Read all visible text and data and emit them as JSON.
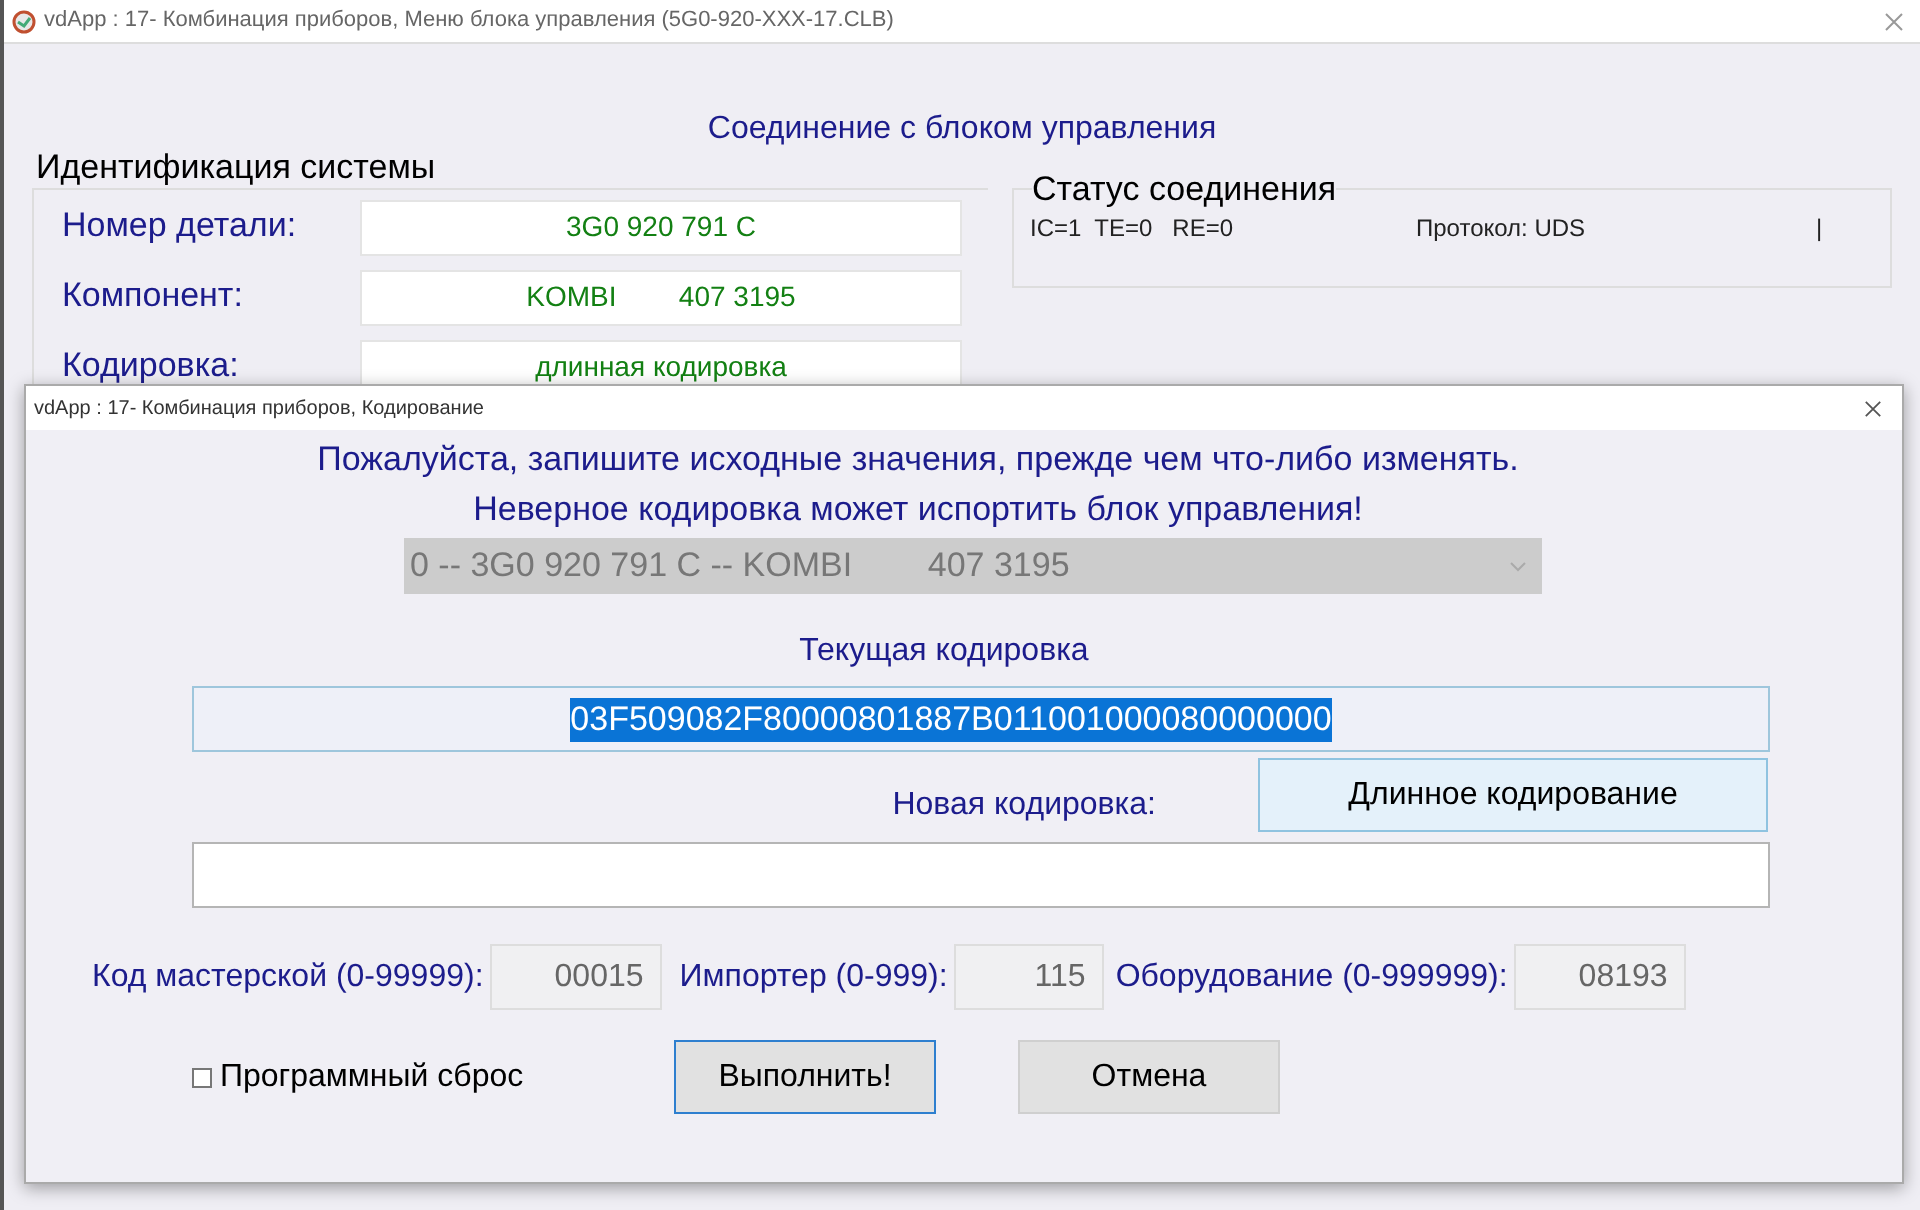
{
  "main_window": {
    "title": "vdApp : 17- Комбинация приборов,  Меню блока управления (5G0-920-XXX-17.CLB)",
    "heading": "Соединение с блоком управления",
    "identification": {
      "title": "Идентификация системы",
      "rows": [
        {
          "label": "Номер детали:",
          "value": "3G0 920 791 C"
        },
        {
          "label": "Компонент:",
          "value": "KOMBI        407 3195"
        },
        {
          "label": "Кодировка:",
          "value": "длинная кодировка"
        }
      ]
    },
    "connection_status": {
      "title": "Статус соединения",
      "counters": "IC=1  TE=0   RE=0",
      "protocol": "Протокол: UDS",
      "indicator": "|"
    }
  },
  "dialog": {
    "title": "vdApp : 17- Комбинация приборов,  Кодирование",
    "warning_lines": [
      "Пожалуйста, запишите исходные значения, прежде чем что-либо изменять.",
      "Неверное кодировка может испортить блок управления!"
    ],
    "module_select": {
      "value": "0 -- 3G0 920 791 C -- KOMBI        407 3195",
      "disabled": true
    },
    "current_coding": {
      "label": "Текущая кодировка",
      "value": "03F509082F80000801887B011001000080000000",
      "selected": true
    },
    "long_coding_button": "Длинное кодирование",
    "new_coding": {
      "label": "Новая кодировка:"
    },
    "fields": [
      {
        "label": "Код мастерской (0-99999):",
        "value": "00015"
      },
      {
        "label": "Импортер (0-999):",
        "value": "115"
      },
      {
        "label": "Оборудование (0-999999):",
        "value": "08193"
      }
    ],
    "soft_reset": {
      "label": "Программный сброс",
      "checked": false
    },
    "buttons": [
      {
        "label": "Выполнить!",
        "focused": true
      },
      {
        "label": "Отмена",
        "focused": false
      }
    ]
  }
}
